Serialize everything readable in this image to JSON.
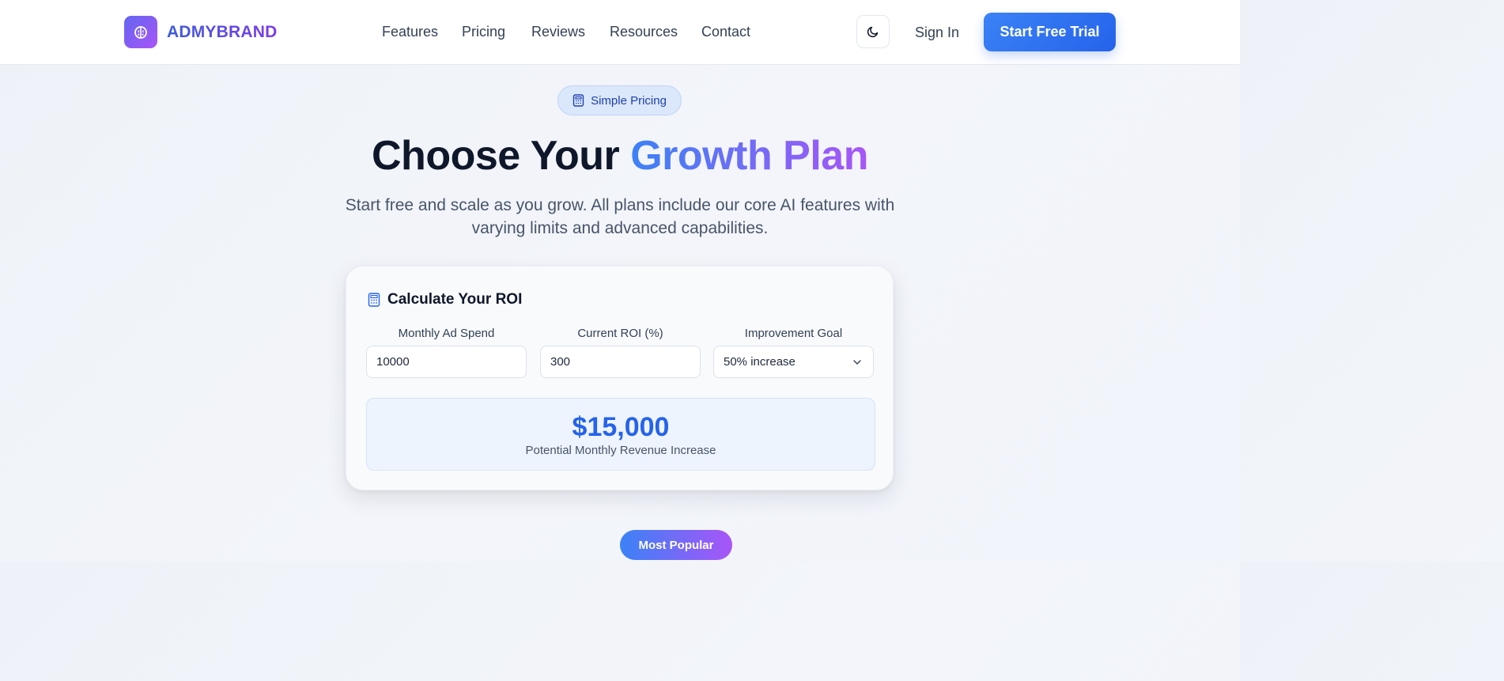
{
  "brand": {
    "name": "ADMYBRAND"
  },
  "nav": {
    "items": [
      {
        "label": "Features"
      },
      {
        "label": "Pricing"
      },
      {
        "label": "Reviews"
      },
      {
        "label": "Resources"
      },
      {
        "label": "Contact"
      }
    ]
  },
  "header": {
    "signin_label": "Sign In",
    "cta_label": "Start Free Trial"
  },
  "hero": {
    "badge": "Simple Pricing",
    "title_plain": "Choose Your ",
    "title_highlight": "Growth Plan",
    "subtitle": "Start free and scale as you grow. All plans include our core AI features with varying limits and advanced capabilities."
  },
  "roi": {
    "title": "Calculate Your ROI",
    "fields": [
      {
        "label": "Monthly Ad Spend",
        "value": "10000"
      },
      {
        "label": "Current ROI (%)",
        "value": "300"
      },
      {
        "label": "Improvement Goal",
        "value": "50% increase"
      }
    ],
    "result_value": "$15,000",
    "result_label": "Potential Monthly Revenue Increase"
  },
  "pricing": {
    "popular_badge": "Most Popular"
  },
  "icons": {
    "logo": "brain-icon",
    "theme": "moon-icon",
    "badge": "calculator-icon",
    "roi": "calculator-icon",
    "select": "chevron-down-icon"
  },
  "colors": {
    "accent_blue": "#2563eb",
    "accent_purple": "#a855f7"
  }
}
